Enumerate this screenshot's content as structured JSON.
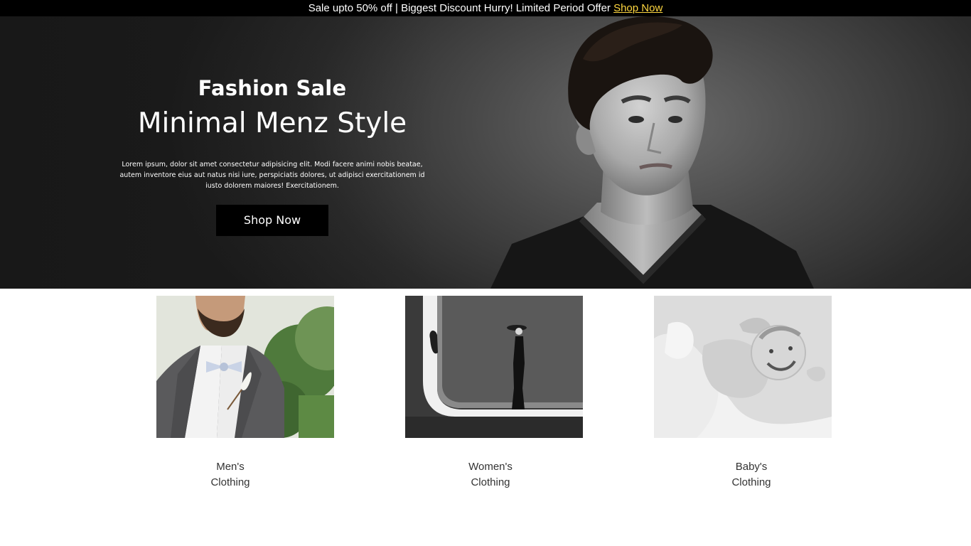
{
  "announcement": {
    "text": "Sale upto 50% off | Biggest Discount Hurry! Limited Period Offer ",
    "link": "Shop Now"
  },
  "hero": {
    "kicker": "Fashion Sale",
    "title": "Minimal Menz Style",
    "description": "Lorem ipsum, dolor sit amet consectetur adipisicing elit. Modi facere animi nobis beatae, autem inventore eius aut natus nisi iure, perspiciatis dolores, ut adipisci exercitationem id iusto dolorem maiores! Exercitationem.",
    "button": "Shop Now"
  },
  "categories": [
    {
      "line1": "Men's",
      "line2": "Clothing"
    },
    {
      "line1": "Women's",
      "line2": "Clothing"
    },
    {
      "line1": "Baby's",
      "line2": "Clothing"
    }
  ],
  "colors": {
    "accent_link": "#ffd740",
    "bar": "#000000",
    "button": "#000000"
  }
}
